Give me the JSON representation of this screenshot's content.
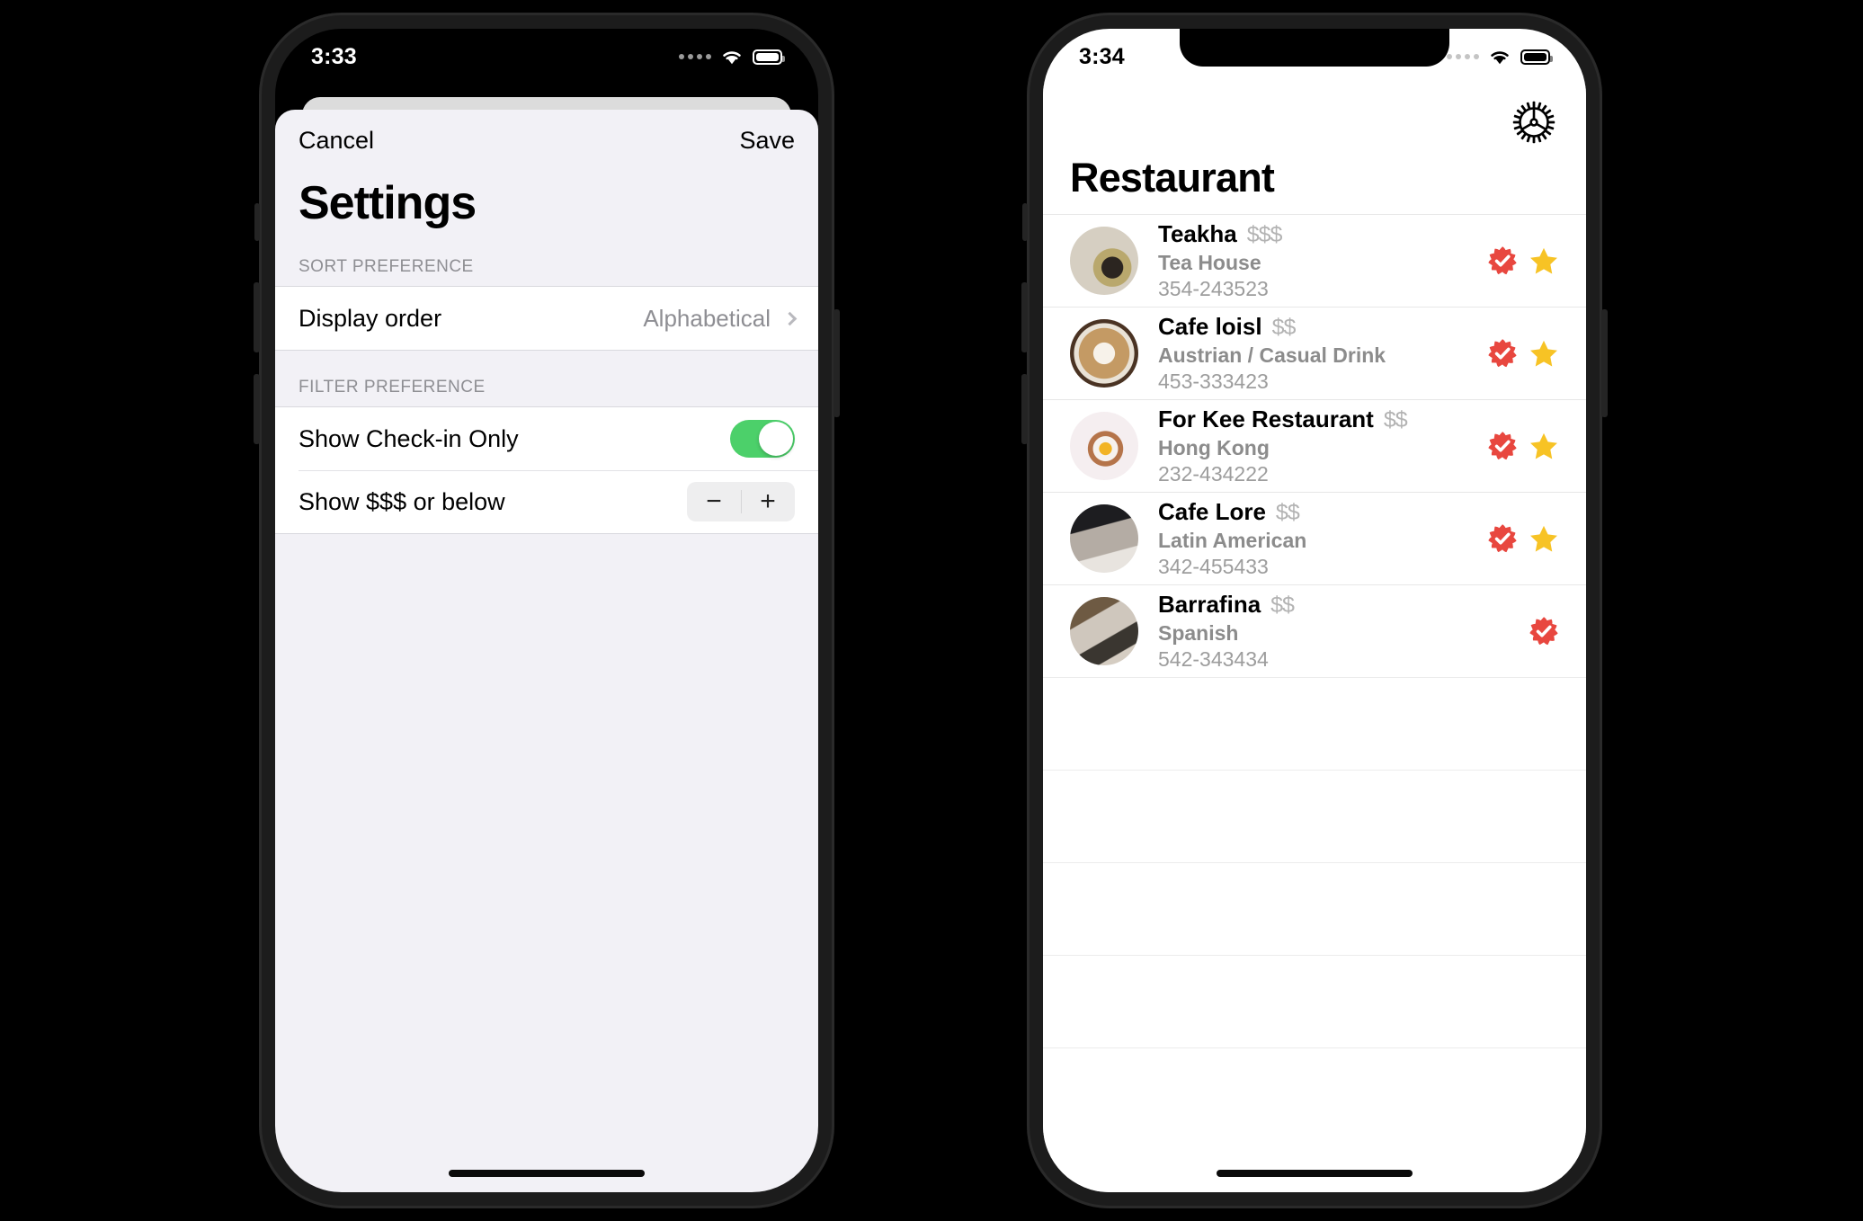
{
  "left_phone": {
    "status_bar": {
      "time": "3:33",
      "wifi_icon": "wifi-icon",
      "battery_icon": "battery-icon",
      "signal_icon": "signal-dots-icon"
    },
    "modal": {
      "cancel_label": "Cancel",
      "save_label": "Save",
      "title": "Settings",
      "sections": [
        {
          "header": "SORT PREFERENCE",
          "rows": [
            {
              "label": "Display order",
              "value": "Alphabetical",
              "control": "disclosure",
              "icon": "chevron-right-icon"
            }
          ]
        },
        {
          "header": "FILTER PREFERENCE",
          "rows": [
            {
              "label": "Show Check-in Only",
              "control": "toggle",
              "toggle_on": true
            },
            {
              "label": "Show $$$ or below",
              "control": "stepper",
              "minus_label": "−",
              "plus_label": "+"
            }
          ]
        }
      ]
    }
  },
  "right_phone": {
    "status_bar": {
      "time": "3:34",
      "wifi_icon": "wifi-icon",
      "battery_icon": "battery-icon",
      "signal_icon": "signal-dots-icon"
    },
    "header": {
      "title": "Restaurant",
      "settings_icon": "gear-icon"
    },
    "restaurants": [
      {
        "name": "Teakha",
        "price": "$$$",
        "type": "Tea House",
        "phone": "354-243523",
        "checked_in": true,
        "favorite": true,
        "thumb": "tea-pot-photo"
      },
      {
        "name": "Cafe loisl",
        "price": "$$",
        "type": "Austrian / Casual Drink",
        "phone": "453-333423",
        "checked_in": true,
        "favorite": true,
        "thumb": "latte-art-photo"
      },
      {
        "name": "For Kee Restaurant",
        "price": "$$",
        "type": "Hong Kong",
        "phone": "232-434222",
        "checked_in": true,
        "favorite": true,
        "thumb": "egg-toast-photo"
      },
      {
        "name": "Cafe Lore",
        "price": "$$",
        "type": "Latin American",
        "phone": "342-455433",
        "checked_in": true,
        "favorite": true,
        "thumb": "cafe-table-photo"
      },
      {
        "name": "Barrafina",
        "price": "$$",
        "type": "Spanish",
        "phone": "542-343434",
        "checked_in": true,
        "favorite": false,
        "thumb": "fine-dining-photo"
      }
    ],
    "empty_row_count": 5
  },
  "colors": {
    "check_badge": "#e8473f",
    "favorite_star": "#f7c325",
    "toggle_on": "#4cd06a",
    "sheet_background": "#f2f1f6",
    "secondary_text": "#8e8e93"
  }
}
